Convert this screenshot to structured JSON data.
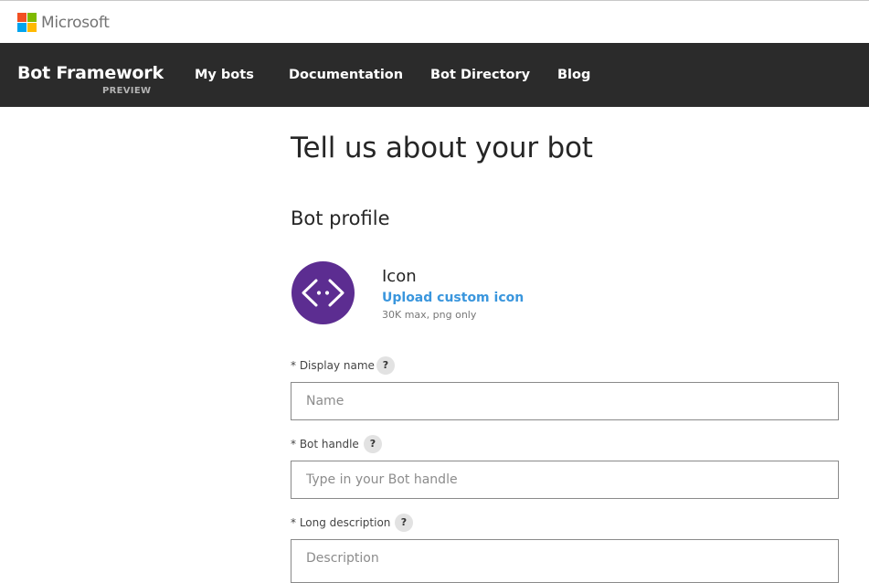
{
  "colors": {
    "nav_background": "#2b2b2b",
    "link": "#3a96dd",
    "bot_icon_background": "#5c2d91",
    "ms_logo": [
      "#f25022",
      "#7fba00",
      "#00a4ef",
      "#ffb900"
    ]
  },
  "ms_header": {
    "logo_icon": "microsoft-four-squares-logo",
    "name": "Microsoft"
  },
  "nav": {
    "brand": "Bot Framework",
    "brand_sub": "PREVIEW",
    "links": [
      "My bots",
      "Documentation",
      "Bot Directory",
      "Blog"
    ]
  },
  "page": {
    "title": "Tell us about your bot",
    "section": "Bot profile"
  },
  "icon_block": {
    "icon": "code-brackets-icon",
    "label": "Icon",
    "upload_link": "Upload custom icon",
    "hint": "30K max, png only"
  },
  "form": {
    "display_name": {
      "label": "* Display name",
      "help": "?",
      "placeholder": "Name",
      "value": ""
    },
    "bot_handle": {
      "label": "* Bot handle",
      "help": "?",
      "placeholder": "Type in your Bot handle",
      "value": ""
    },
    "long_description": {
      "label": "* Long description",
      "help": "?",
      "placeholder": "Description",
      "value": ""
    }
  }
}
